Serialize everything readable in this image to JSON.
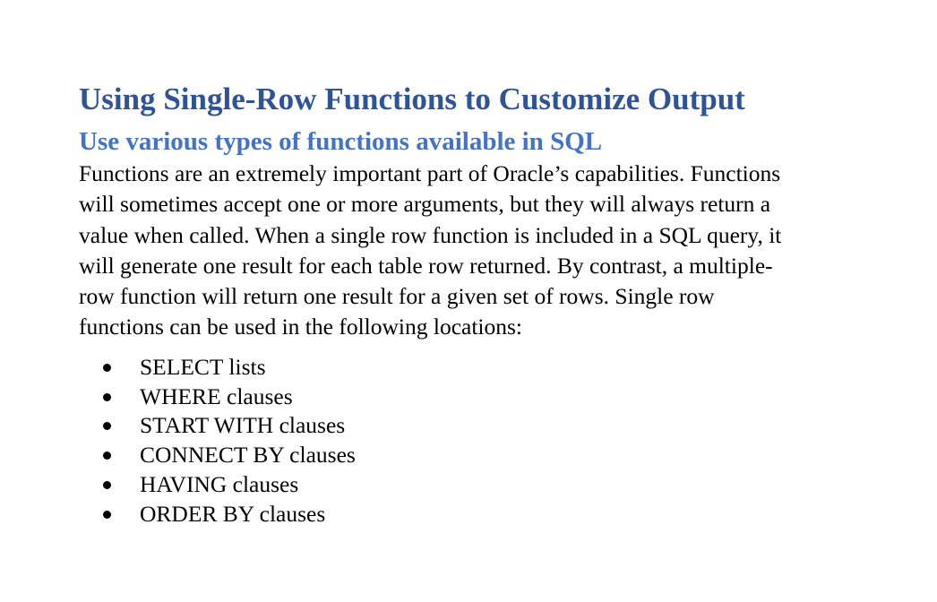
{
  "document": {
    "title": "Using Single-Row Functions to Customize Output",
    "subtitle": "Use various types of functions available in SQL",
    "paragraph_lines": [
      "Functions are an extremely important part of Oracle’s capabilities. Functions",
      "will sometimes accept one or more arguments, but they will always return a",
      "value when called. When a single row function is included in a SQL query, it",
      "will generate one result for each table row returned. By contrast, a multiple-",
      "row function will return one result for a given set of rows. Single row",
      "functions can be used in the following locations:"
    ],
    "bullets": [
      "SELECT lists",
      "WHERE clauses",
      "START WITH clauses",
      "CONNECT BY clauses",
      "HAVING clauses",
      "ORDER BY clauses"
    ]
  },
  "colors": {
    "title": "#2f5496",
    "subtitle": "#4472c4",
    "body": "#000000"
  }
}
